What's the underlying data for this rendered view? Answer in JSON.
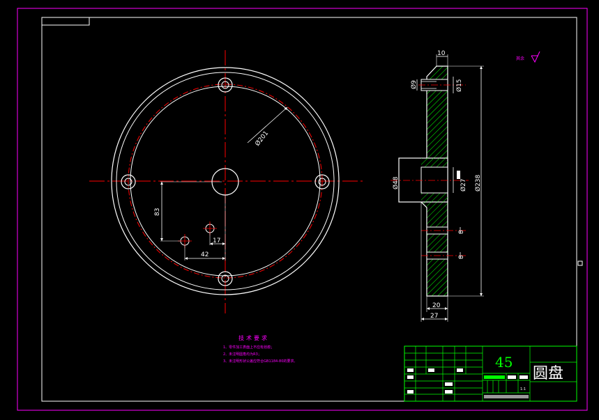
{
  "front_view": {
    "pcd_label": "Ø201",
    "height_dim": "83",
    "offset_small": "17",
    "offset_large": "42"
  },
  "section_view": {
    "top_width": "10",
    "hole_left": "Ø9",
    "hole_right": "Ø15",
    "hub_left": "Ø48",
    "hub_right": "Ø27",
    "outer_dia": "Ø238",
    "slot1": "8",
    "slot2": "8",
    "web_width": "20",
    "total_width": "27"
  },
  "roughness": {
    "label": "其余"
  },
  "tech_notes": {
    "title": "技术要求",
    "items": [
      "1、零件加工表面上不应有划痕；",
      "2、未注明圆角均为R3；",
      "3、未注明形状公差应符合GB1184-80的要求。"
    ]
  },
  "title_block": {
    "material": "45",
    "part_name": "圆盘",
    "scale": "1:1"
  },
  "colors": {
    "border": "#ff00ff",
    "frame": "#ffffff",
    "centerline": "#ff0000",
    "hatch": "#00ff00",
    "tb_grid": "#00ff00"
  }
}
